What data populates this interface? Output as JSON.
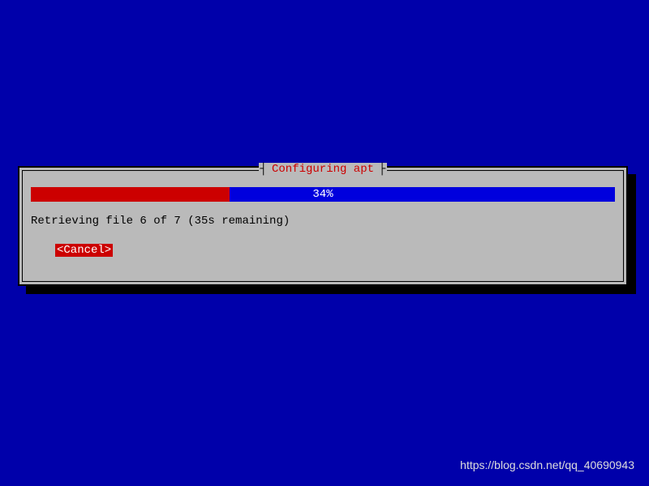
{
  "dialog": {
    "title": "Configuring apt",
    "title_bracket_left": "┤",
    "title_bracket_right": "├",
    "progress": {
      "percent": 34,
      "label": "34%"
    },
    "status": "Retrieving file 6 of 7 (35s remaining)",
    "cancel_label": "<Cancel>"
  },
  "watermark": "https://blog.csdn.net/qq_40690943"
}
